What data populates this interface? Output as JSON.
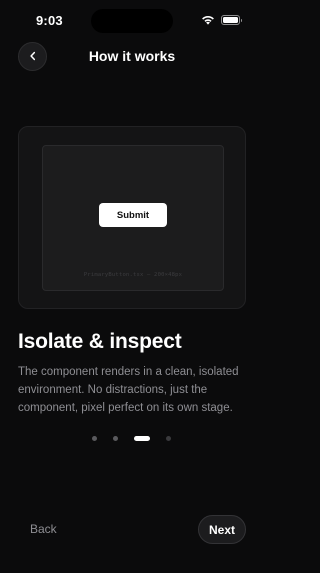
{
  "status_bar": {
    "time": "9:03",
    "icons": [
      "wifi-icon",
      "battery-icon"
    ]
  },
  "header": {
    "title": "How it works",
    "back_icon": "chevron-left-icon"
  },
  "preview": {
    "button_label": "Submit",
    "caption": "PrimaryButton.tsx — 200×48px"
  },
  "content": {
    "headline": "Isolate & inspect",
    "description": "The component renders in a clean, isolated environment. No distractions, just the component, pixel perfect on its own stage."
  },
  "pagination": {
    "total": 4,
    "current": 3
  },
  "footer": {
    "back_label": "Back",
    "next_label": "Next"
  },
  "colors": {
    "background": "#0b0b0c",
    "text_primary": "#ffffff",
    "text_secondary": "#8e8e93",
    "surface": "#1c1c1e",
    "accent": "#ffffff"
  }
}
